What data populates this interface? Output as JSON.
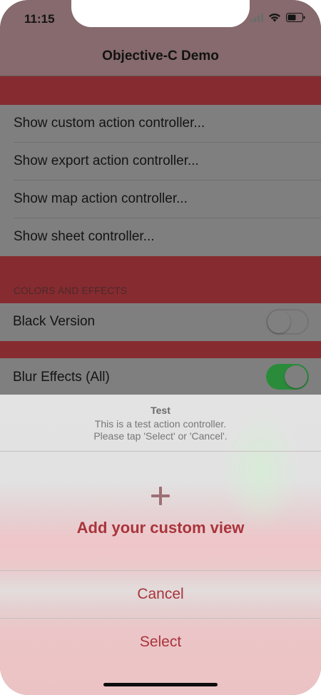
{
  "status_bar": {
    "time": "11:15"
  },
  "nav": {
    "title": "Objective-C Demo"
  },
  "menu_rows": [
    {
      "label": "Show custom action controller..."
    },
    {
      "label": "Show export action controller..."
    },
    {
      "label": "Show map action controller..."
    },
    {
      "label": "Show sheet controller..."
    }
  ],
  "section": {
    "header": "COLORS AND EFFECTS"
  },
  "toggles": [
    {
      "label": "Black Version",
      "on": false
    },
    {
      "label": "Blur Effects (All)",
      "on": true
    }
  ],
  "sheet": {
    "title": "Test",
    "message_line1": "This is a test action controller.",
    "message_line2": "Please tap 'Select' or 'Cancel'.",
    "custom_view_label": "Add your custom view",
    "cancel_label": "Cancel",
    "select_label": "Select"
  },
  "colors": {
    "accent": "#a9343b",
    "overlay_band": "#862b2f",
    "switch_on": "#2a8c3a"
  }
}
